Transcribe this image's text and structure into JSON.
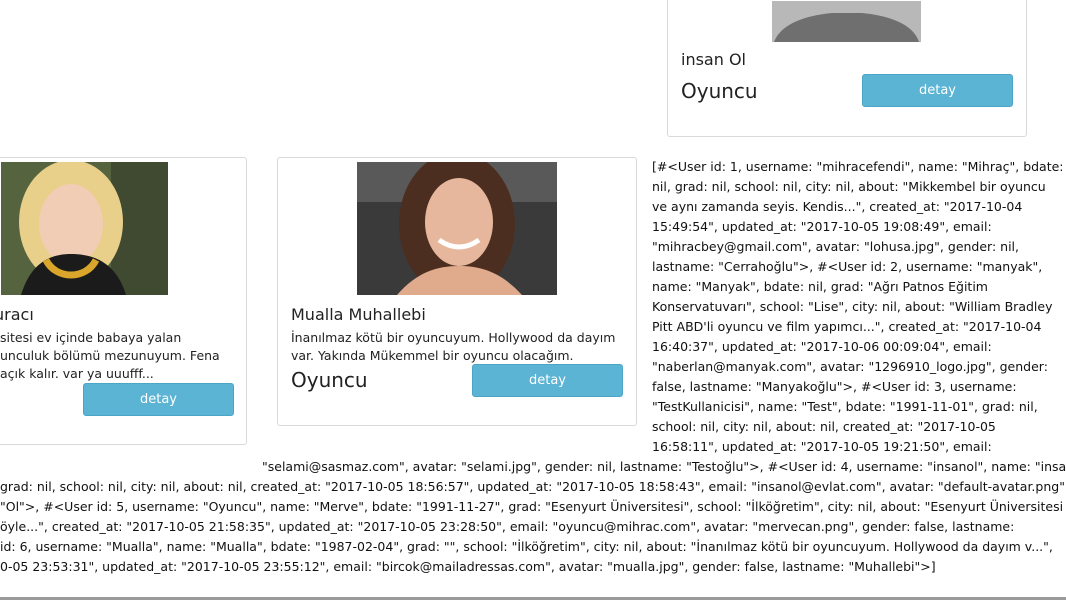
{
  "cards": {
    "top": {
      "name": "insan Ol",
      "role": "Oyuncu",
      "button": "detay"
    },
    "left": {
      "name": "uracı",
      "about_lines": [
        "sitesi ev içinde babaya yalan",
        "unculuk bölümü mezunuyum. Fena",
        "açık kalır. var ya uuufff..."
      ],
      "button": "detay"
    },
    "middle": {
      "name": "Mualla Muhallebi",
      "about_lines": [
        "İnanılmaz kötü bir oyuncuyum. Hollywood da dayım",
        "var. Yakında Mükemmel bir oyuncu olacağım."
      ],
      "role": "Oyuncu",
      "button": "detay"
    }
  },
  "debug_dump": {
    "right_lines": [
      "[#<User id: 1, username: \"mihracefendi\", name: \"Mihraç\", bdate:",
      "nil, grad: nil, school: nil, city: nil, about: \"Mikkembel bir oyuncu",
      "ve aynı zamanda seyis. Kendis...\", created_at: \"2017-10-04",
      "15:49:54\", updated_at: \"2017-10-05 19:08:49\", email:",
      "\"mihracbey@gmail.com\", avatar: \"lohusa.jpg\", gender: nil,",
      "lastname: \"Cerrahoğlu\">, #<User id: 2, username: \"manyak\",",
      "name: \"Manyak\", bdate: nil, grad: \"Ağrı Patnos Eğitim",
      "Konservatuvarı\", school: \"Lise\", city: nil, about: \"William Bradley",
      "Pitt ABD'li oyuncu ve film yapımcı...\", created_at: \"2017-10-04",
      "16:40:37\", updated_at: \"2017-10-06 00:09:04\", email:",
      "\"naberlan@manyak.com\", avatar: \"1296910_logo.jpg\", gender:",
      "false, lastname: \"Manyakoğlu\">, #<User id: 3, username:",
      "\"TestKullanicisi\", name: \"Test\", bdate: \"1991-11-01\", grad: nil,",
      "school: nil, city: nil, about: nil, created_at: \"2017-10-05",
      "16:58:11\", updated_at: \"2017-10-05 19:21:50\", email:"
    ],
    "bottom_lines": [
      "\"selami@sasmaz.com\", avatar: \"selami.jpg\", gender: nil, lastname: \"Testoğlu\">, #<User id: 4, username: \"insanol\", name: \"insan\",",
      " grad: nil, school: nil, city: nil, about: nil, created_at: \"2017-10-05 18:56:57\", updated_at: \"2017-10-05 18:58:43\", email: \"insanol@evlat.com\", avatar: \"default-avatar.png\",",
      "\"Ol\">, #<User id: 5, username: \"Oyuncu\", name: \"Merve\", bdate: \"1991-11-27\", grad: \"Esenyurt Üniversitesi\", school: \"İlköğretim\", city: nil, about: \"Esenyurt Üniversitesi ev",
      "öyle...\", created_at: \"2017-10-05 21:58:35\", updated_at: \"2017-10-05 23:28:50\", email: \"oyuncu@mihrac.com\", avatar: \"mervecan.png\", gender: false, lastname:",
      "id: 6, username: \"Mualla\", name: \"Mualla\", bdate: \"1987-02-04\", grad: \"\", school: \"İlköğretim\", city: nil, about: \"İnanılmaz kötü bir oyuncuyum. Hollywood da dayım v...\",",
      "0-05 23:53:31\", updated_at: \"2017-10-05 23:55:12\", email: \"bircok@mailadressas.com\", avatar: \"mualla.jpg\", gender: false, lastname: \"Muhallebi\">]"
    ]
  },
  "colors": {
    "button": "#5bb4d3",
    "button_text": "#ffffff",
    "border": "#d9d9d9"
  },
  "icons": {
    "default_avatar": "user-silhouette-icon"
  }
}
